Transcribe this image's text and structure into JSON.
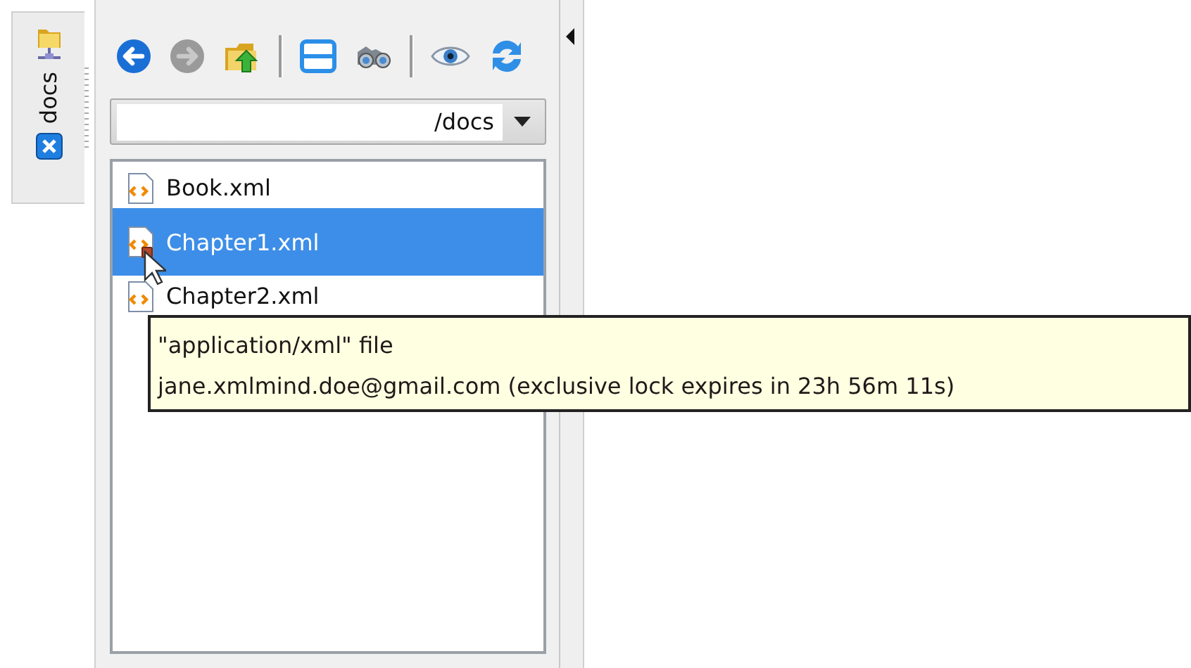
{
  "side_tab": {
    "label": "docs",
    "selected": true
  },
  "toolbar": [
    {
      "kind": "back",
      "disabled": false
    },
    {
      "kind": "forward",
      "disabled": true
    },
    {
      "kind": "parent"
    },
    {
      "kind": "separator"
    },
    {
      "kind": "layout"
    },
    {
      "kind": "find"
    },
    {
      "kind": "separator"
    },
    {
      "kind": "view"
    },
    {
      "kind": "refresh"
    }
  ],
  "path_field": {
    "value": "/docs"
  },
  "files": [
    {
      "name": "Book.xml",
      "selected": false,
      "locked": false
    },
    {
      "name": "Chapter1.xml",
      "selected": true,
      "locked": true
    },
    {
      "name": "Chapter2.xml",
      "selected": false,
      "locked": false
    }
  ],
  "tooltip": {
    "lines": [
      "\"application/xml\" file",
      "jane.xmlmind.doe@gmail.com (exclusive lock expires in 23h 56m 11s)"
    ]
  }
}
